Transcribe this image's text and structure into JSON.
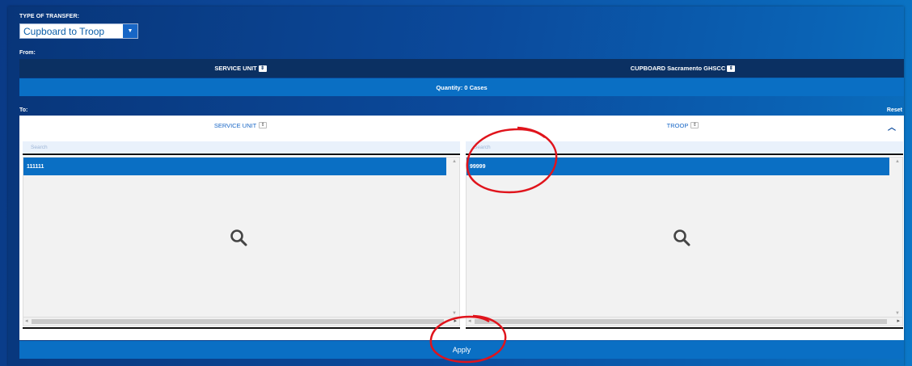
{
  "transfer": {
    "type_label": "TYPE OF TRANSFER:",
    "type_value": "Cupboard to Troop",
    "caret": "▼"
  },
  "from": {
    "label": "From:",
    "col1": "SERVICE UNIT",
    "col2": "CUPBOARD Sacramento GHSCC",
    "quantity": "Quantity: 0 Cases"
  },
  "to": {
    "label": "To:",
    "reset": "Reset",
    "col1": "SERVICE UNIT",
    "col2": "TROOP",
    "left": {
      "search_placeholder": "Search",
      "items": [
        "111111"
      ]
    },
    "right": {
      "search_placeholder": "Search",
      "items": [
        "99999"
      ]
    }
  },
  "apply_label": "Apply",
  "colors": {
    "accent": "#0a6fc4",
    "header_dark": "#0b3062",
    "annotation": "#e0141c"
  }
}
